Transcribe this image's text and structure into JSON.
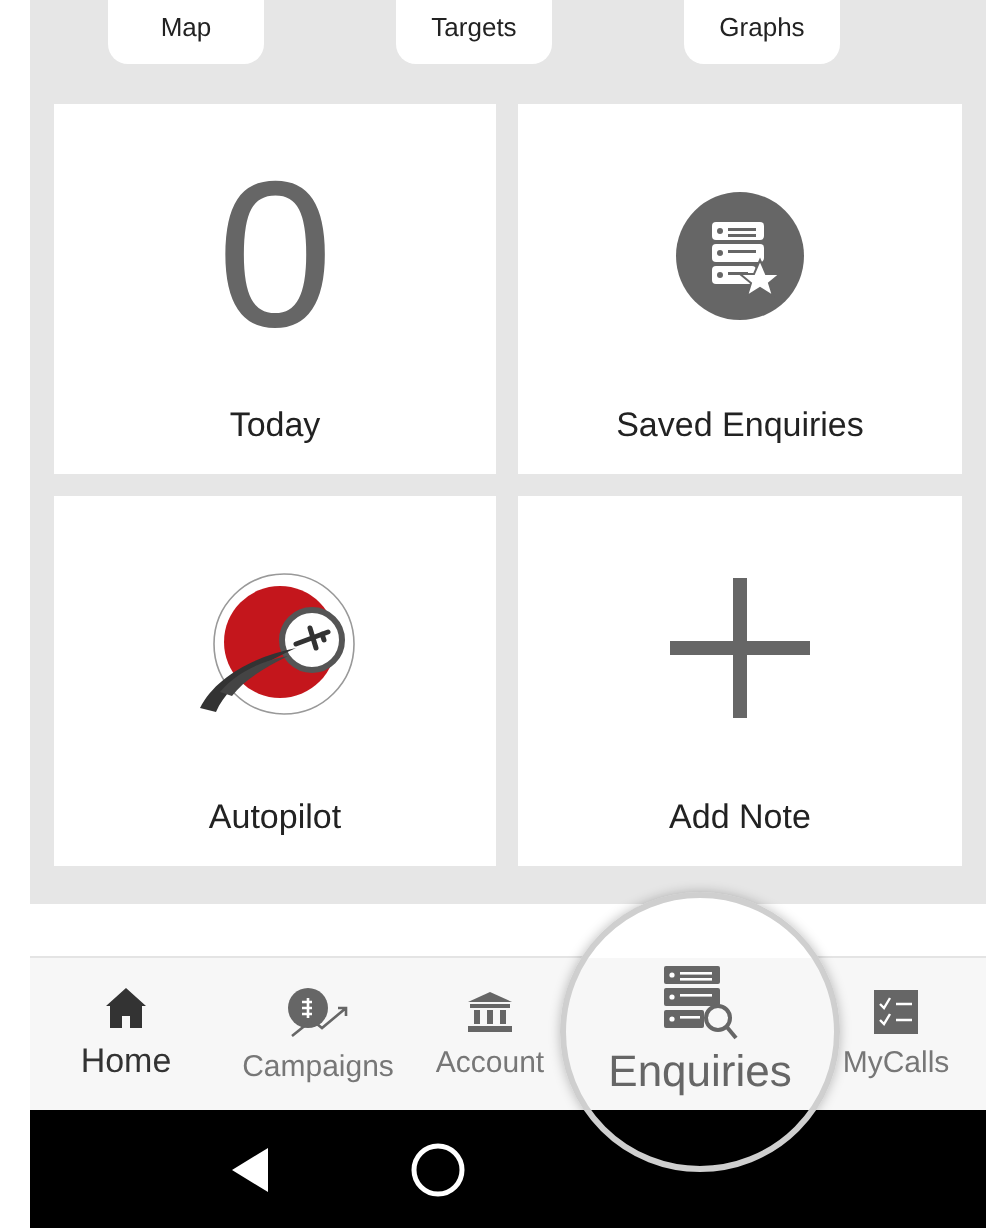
{
  "top_tabs": [
    {
      "label": "Map"
    },
    {
      "label": "Targets"
    },
    {
      "label": "Graphs"
    }
  ],
  "tiles": [
    {
      "kind": "counter",
      "value": "0",
      "label": "Today"
    },
    {
      "kind": "saved",
      "label": "Saved Enquiries"
    },
    {
      "kind": "logo",
      "label": "Autopilot"
    },
    {
      "kind": "add",
      "label": "Add Note"
    }
  ],
  "nav": [
    {
      "kind": "home",
      "label": "Home",
      "selected": true
    },
    {
      "kind": "campaigns",
      "label": "Campaigns",
      "selected": false
    },
    {
      "kind": "account",
      "label": "Account",
      "selected": false
    },
    {
      "kind": "enquiries",
      "label": "Enquiries",
      "selected": false
    },
    {
      "kind": "calls",
      "label": "MyCalls",
      "selected": false
    }
  ]
}
